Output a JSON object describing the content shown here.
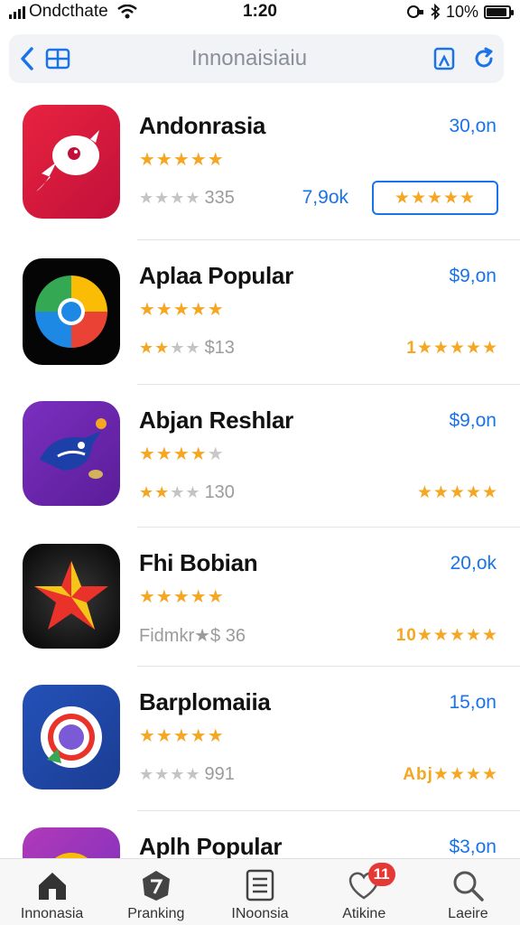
{
  "status_bar": {
    "carrier": "Ondcthate",
    "time": "1:20",
    "battery": "10%",
    "battery_level": 0.9
  },
  "top_bar": {
    "title": "Innonaisiaiu",
    "icons": [
      "back-chevron-icon",
      "grid-icon",
      "bookmark-icon",
      "refresh-icon"
    ]
  },
  "apps": [
    {
      "name": "Andonrasia",
      "price": "30,on",
      "stars": "★★★★★",
      "sub_stars_lit": "",
      "sub_stars_dim": "★★★★",
      "sub_count": "335",
      "sub_mid": "7,9ok",
      "rate": "★★★★★"
    },
    {
      "name": "Aplaa Popular",
      "price": "$9,on",
      "stars": "★★★★★",
      "sub_stars_lit": "★★",
      "sub_stars_dim": "★★",
      "sub_count": "$13",
      "sub_mid": "",
      "rate": "1★★★★★"
    },
    {
      "name": "Abjan Reshlar",
      "price": "$9,on",
      "stars": "★★★★",
      "stars_dim": "★",
      "sub_stars_lit": "★★",
      "sub_stars_dim": "★★",
      "sub_count": "130",
      "sub_mid": "",
      "rate": "★★★★★"
    },
    {
      "name": "Fhi Bobian",
      "price": "20,ok",
      "stars": "★★★★★",
      "sub_stars_lit": "",
      "sub_stars_dim": "",
      "sub_count": "Fidmkr★$ 36",
      "sub_mid": "",
      "rate": "10★★★★★"
    },
    {
      "name": "Barplomaiia",
      "price": "15,on",
      "stars": "★★★★★",
      "sub_stars_lit": "",
      "sub_stars_dim": "★★★★",
      "sub_count": "991",
      "sub_mid": "",
      "rate": "Abj★★★★"
    },
    {
      "name": "Aplh Popular",
      "price": "$3,on"
    }
  ],
  "tabs": [
    {
      "label": "Innonasia",
      "icon": "home-icon"
    },
    {
      "label": "Pranking",
      "icon": "ranking-icon"
    },
    {
      "label": "INoonsia",
      "icon": "list-icon"
    },
    {
      "label": "Atikine",
      "icon": "heart-icon",
      "badge": "11"
    },
    {
      "label": "Laeire",
      "icon": "search-icon"
    }
  ],
  "colors": {
    "accent": "#1a73e8",
    "star": "#f5a623",
    "badge": "#e53935"
  }
}
